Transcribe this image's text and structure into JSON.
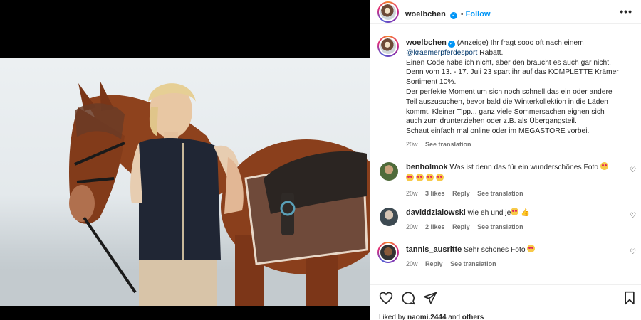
{
  "post": {
    "author": "woelbchen",
    "follow_label": "Follow",
    "more_label": "•••"
  },
  "caption": {
    "author": "woelbchen",
    "lines": [
      "(Anzeige) Ihr fragt sooo oft nach einem",
      "@kraemerpferdesport Rabatt.",
      "Einen Code habe ich nicht, aber den braucht es auch gar nicht.",
      "Denn vom 13. - 17. Juli 23 spart ihr auf das KOMPLETTE Krämer",
      "Sortiment 10%.",
      "Der perfekte Moment um sich noch schnell das ein oder andere",
      "Teil auszusuchen, bevor bald die Winterkollektion in die Läden",
      "kommt. Kleiner Tipp... ganz viele Sommersachen eignen sich",
      "auch zum drunterziehen oder z.B. als Übergangsteil.",
      "Schaut einfach mal online oder im MEGASTORE vorbei."
    ],
    "mention": "@kraemerpferdesport",
    "mention_rest": " Rabatt.",
    "age": "20w",
    "see_translation": "See translation"
  },
  "comments": [
    {
      "user": "benholmok",
      "text": "Was ist denn das für ein wunderschönes Foto",
      "age": "20w",
      "likes": "3 likes",
      "reply": "Reply",
      "see_translation": "See translation"
    },
    {
      "user": "daviddzialowski",
      "text": "wie eh und je",
      "age": "20w",
      "likes": "2 likes",
      "reply": "Reply",
      "see_translation": "See translation"
    },
    {
      "user": "tannis_ausritte",
      "text": "Sehr schönes Foto",
      "age": "20w",
      "reply": "Reply",
      "see_translation": "See translation"
    }
  ],
  "likes_bar": {
    "prefix": "Liked by ",
    "user": "naomi.2444",
    "middle": " and ",
    "others": "others"
  },
  "colors": {
    "accent": "#0095f6",
    "text": "#262626",
    "muted": "#737373"
  },
  "icons": [
    "more-icon",
    "verified-icon",
    "heart-icon",
    "comment-icon",
    "share-icon",
    "bookmark-icon"
  ]
}
